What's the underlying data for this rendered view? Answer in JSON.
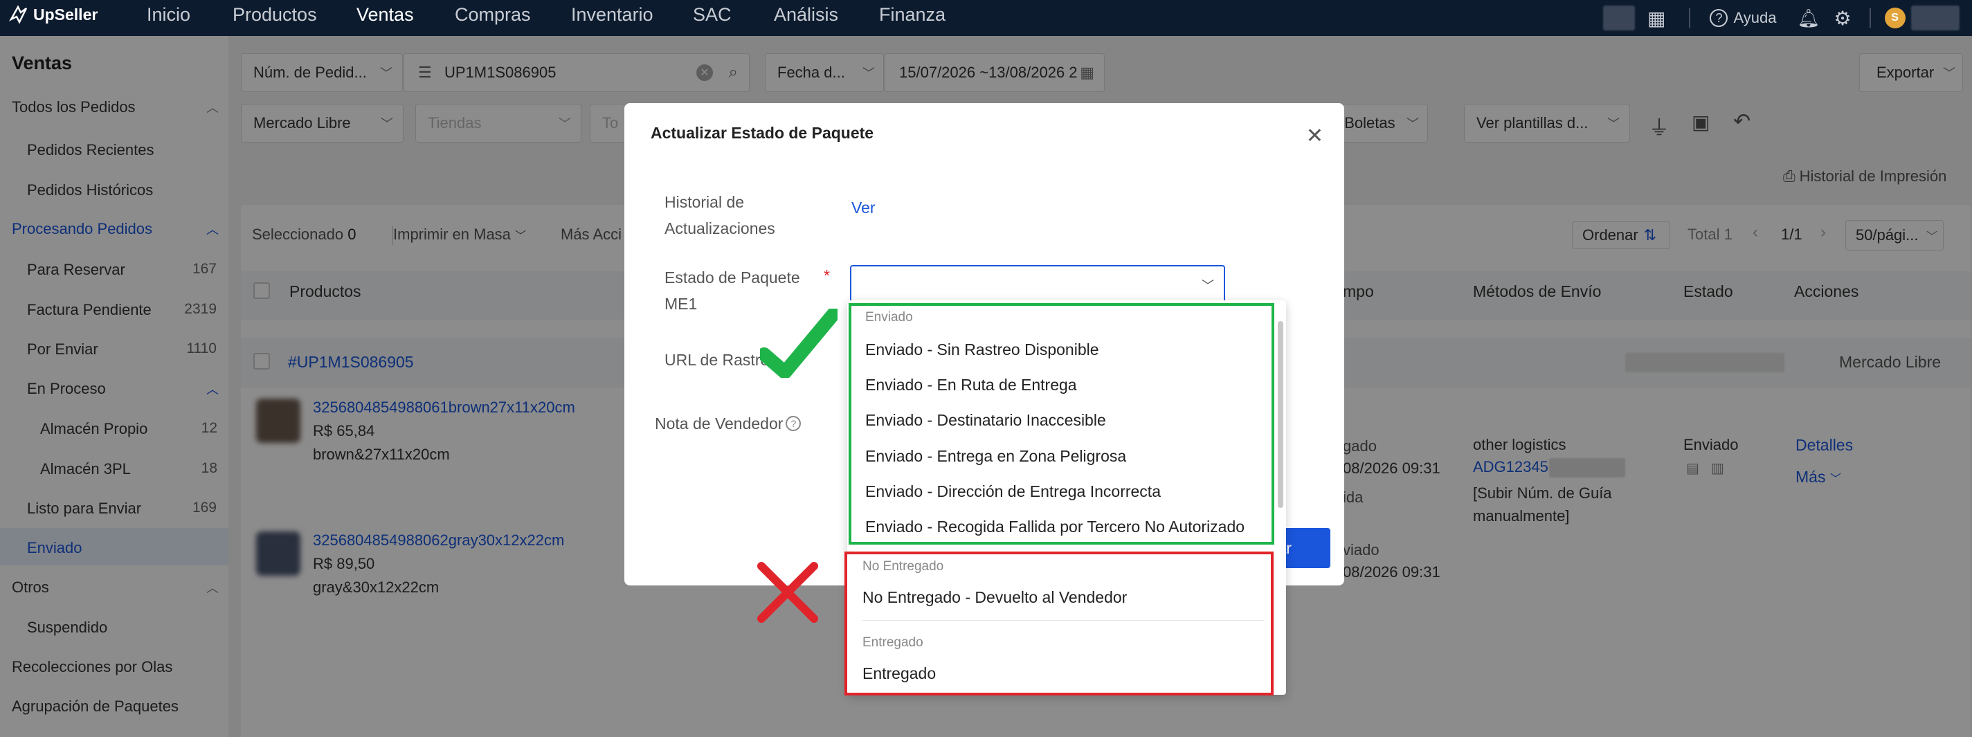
{
  "app": {
    "brand": "UpSeller"
  },
  "topnav": {
    "items": [
      "Inicio",
      "Productos",
      "Ventas",
      "Compras",
      "Inventario",
      "SAC",
      "Análisis",
      "Finanza"
    ],
    "help": "Ayuda"
  },
  "sidebar": {
    "title": "Ventas",
    "items": [
      {
        "label": "Todos los Pedidos",
        "count": ""
      },
      {
        "label": "Pedidos Recientes",
        "count": ""
      },
      {
        "label": "Pedidos Históricos",
        "count": ""
      },
      {
        "label": "Procesando Pedidos",
        "count": ""
      },
      {
        "label": "Para Reservar",
        "count": "167"
      },
      {
        "label": "Factura Pendiente",
        "count": "2319"
      },
      {
        "label": "Por Enviar",
        "count": "1110"
      },
      {
        "label": "En Proceso",
        "count": ""
      },
      {
        "label": "Almacén Propio",
        "count": "12"
      },
      {
        "label": "Almacén 3PL",
        "count": "18"
      },
      {
        "label": "Listo para Enviar",
        "count": "169"
      },
      {
        "label": "Enviado",
        "count": ""
      },
      {
        "label": "Otros",
        "count": ""
      },
      {
        "label": "Suspendido",
        "count": ""
      },
      {
        "label": "Recolecciones por Olas",
        "count": ""
      },
      {
        "label": "Agrupación de Paquetes",
        "count": ""
      }
    ]
  },
  "filters": {
    "search_type": "Núm. de Pedid...",
    "search_value": "UP1M1S086905",
    "date_type": "Fecha d...",
    "date_range": "15/07/2026 ~13/08/2026 2",
    "export": "Exportar",
    "marketplace": "Mercado Libre",
    "stores_placeholder": "Tiendas",
    "third_partial": "To",
    "boletas": "las Boletas",
    "templates": "Ver plantillas d...",
    "print_history": "Historial de Impresión"
  },
  "toolbar": {
    "selected_label": "Seleccionado",
    "selected_count": "0",
    "bulk_print": "Imprimir en Masa",
    "more_actions": "Más Acci",
    "order": "Ordenar",
    "total": "Total 1",
    "pages": "1/1",
    "per_page": "50/pági..."
  },
  "table": {
    "headers": {
      "products": "Productos",
      "time": "mpo",
      "shipping": "Métodos de Envío",
      "status": "Estado",
      "actions": "Acciones"
    },
    "order_id": "#UP1M1S086905",
    "platform": "Mercado Libre",
    "rows": [
      {
        "sku": "3256804854988061brown27x11x20cm",
        "price": "R$ 65,84",
        "variant": "brown&27x11x20cm"
      },
      {
        "sku": "3256804854988062gray30x12x22cm",
        "price": "R$ 89,50",
        "variant": "gray&30x12x22cm"
      }
    ],
    "time1_label": "gado",
    "time1": "08/2026 09:31",
    "time_mid": "ida",
    "time2_label": "viado",
    "time2": "08/2026 09:31",
    "shipping_method": "other logistics",
    "tracking": "ADG12345",
    "tracking_note": "[Subir Núm. de Guía manualmente]",
    "status": "Enviado",
    "details": "Detalles",
    "more": "Más"
  },
  "modal": {
    "title": "Actualizar Estado de Paquete",
    "history_label": "Historial de Actualizaciones",
    "history_link": "Ver",
    "status_label": "Estado de Paquete ME1",
    "url_label": "URL de Rastreo",
    "note_label": "Nota de Vendedor",
    "submit_partial": "zar"
  },
  "dropdown": {
    "groups": [
      {
        "label": "Enviado",
        "options": [
          "Enviado - Sin Rastreo Disponible",
          "Enviado - En Ruta de Entrega",
          "Enviado - Destinatario Inaccesible",
          "Enviado - Entrega en Zona Peligrosa",
          "Enviado - Dirección de Entrega Incorrecta",
          "Enviado - Recogida Fallida por Tercero No Autorizado"
        ]
      },
      {
        "label": "No Entregado",
        "options": [
          "No Entregado - Devuelto al Vendedor"
        ]
      },
      {
        "label": "Entregado",
        "options": [
          "Entregado"
        ]
      }
    ]
  },
  "colors": {
    "nav": "#0d1b2e",
    "accent": "#1a56db",
    "check": "#1fb44a",
    "cross": "#e1242b"
  }
}
